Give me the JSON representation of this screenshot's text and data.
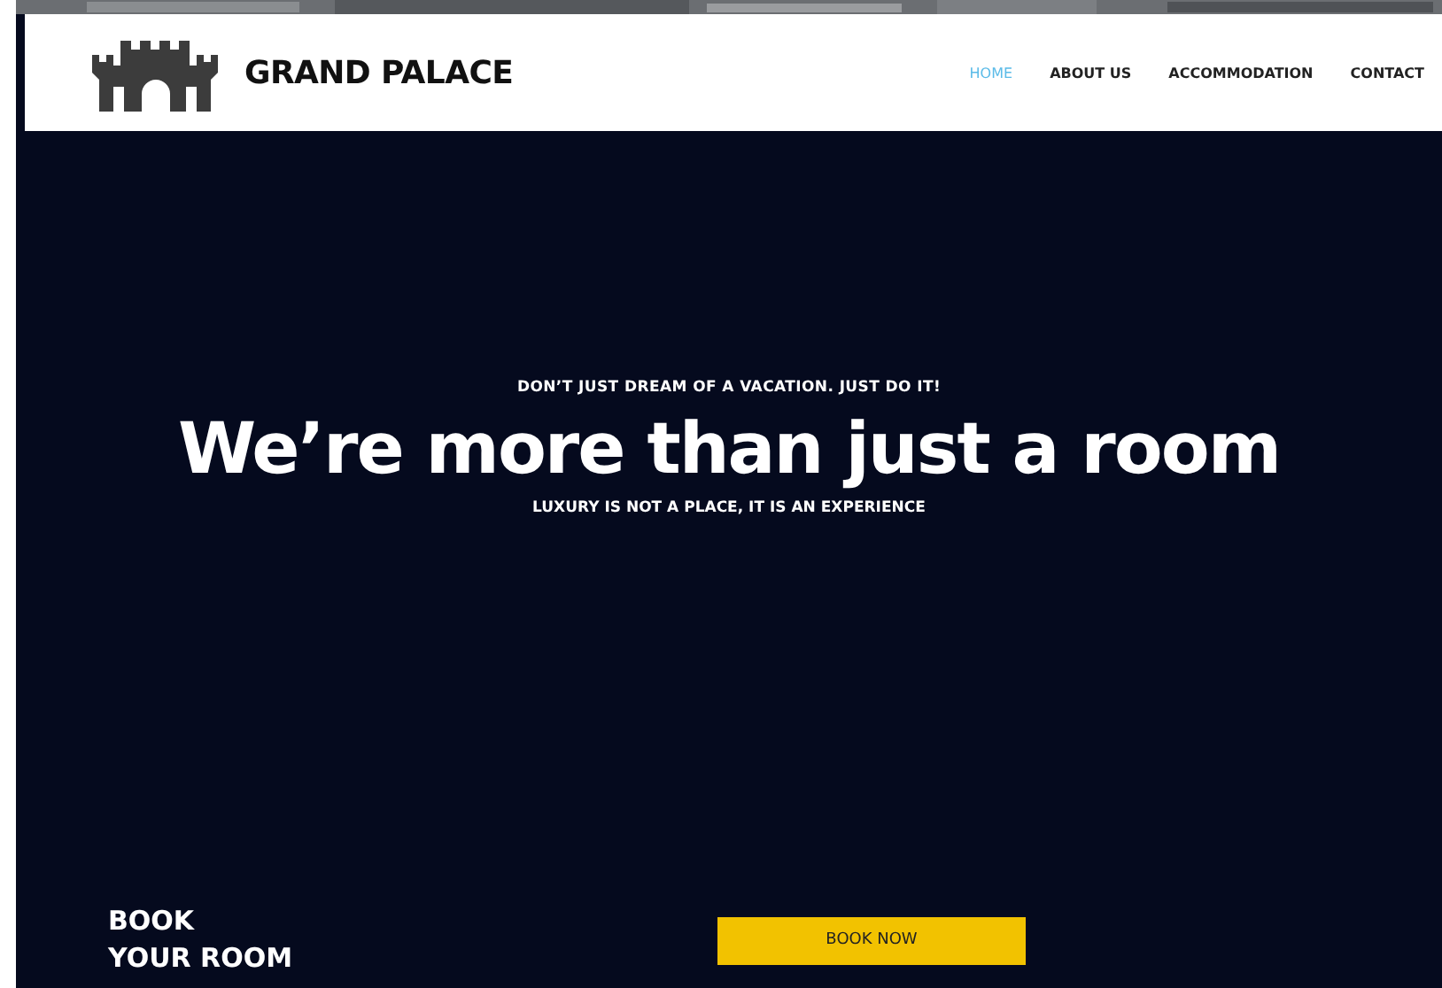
{
  "header": {
    "brand": "GRAND PALACE",
    "nav": [
      {
        "label": "HOME",
        "selected": true
      },
      {
        "label": "ABOUT US",
        "selected": false
      },
      {
        "label": "ACCOMMODATION",
        "selected": false
      },
      {
        "label": "CONTACT",
        "selected": false
      }
    ]
  },
  "hero": {
    "kicker": "DON’T JUST DREAM OF A VACATION. JUST DO IT!",
    "title": "We’re more than just a room",
    "subtitle": "LUXURY IS NOT A PLACE, IT IS AN EXPERIENCE"
  },
  "booking": {
    "heading": [
      "BOOK",
      "YOUR ROOM"
    ],
    "button": "BOOK NOW"
  }
}
